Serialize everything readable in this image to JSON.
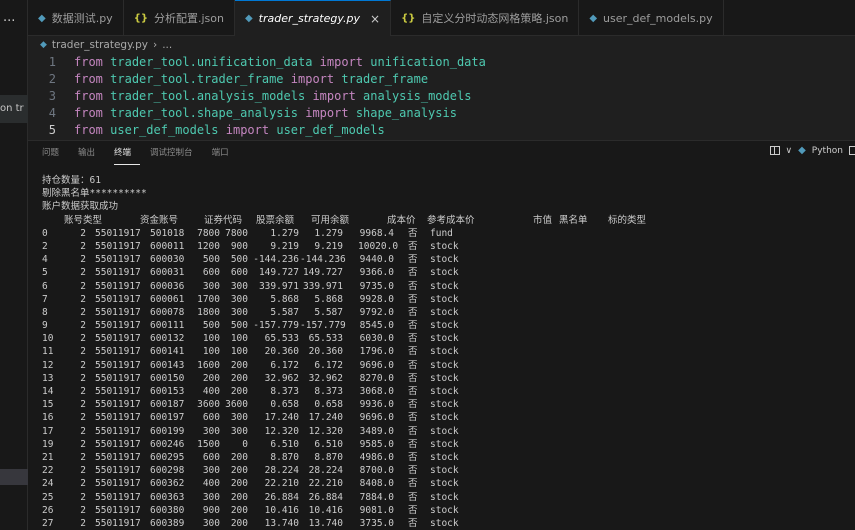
{
  "left_strip": {
    "ellipsis": "···",
    "partial_text": "on tr",
    "top_glyphs": "·· ·····"
  },
  "tabs": [
    {
      "label": "数据测试.py",
      "icon": "python-file-icon",
      "active": false
    },
    {
      "label": "分析配置.json",
      "icon": "json-file-icon",
      "active": false
    },
    {
      "label": "trader_strategy.py",
      "icon": "python-file-icon",
      "active": true
    },
    {
      "label": "自定义分时动态网格策略.json",
      "icon": "json-file-icon",
      "active": false
    },
    {
      "label": "user_def_models.py",
      "icon": "python-file-icon",
      "active": false
    }
  ],
  "tab_close_glyph": "×",
  "breadcrumb": {
    "file": "trader_strategy.py",
    "separator": "›",
    "rest": "..."
  },
  "editor": {
    "lines": [
      {
        "n": "1",
        "kw1": "from",
        "mod": "trader_tool.unification_data",
        "kw2": "import",
        "name": "unification_data"
      },
      {
        "n": "2",
        "kw1": "from",
        "mod": "trader_tool.trader_frame",
        "kw2": "import",
        "name": "trader_frame"
      },
      {
        "n": "3",
        "kw1": "from",
        "mod": "trader_tool.analysis_models",
        "kw2": "import",
        "name": "analysis_models"
      },
      {
        "n": "4",
        "kw1": "from",
        "mod": "trader_tool.shape_analysis",
        "kw2": "import",
        "name": "shape_analysis"
      },
      {
        "n": "5",
        "kw1": "from",
        "mod": "user_def_models",
        "kw2": "import",
        "name": "user_def_models"
      }
    ]
  },
  "panel": {
    "tabs": [
      "问题",
      "输出",
      "终端",
      "调试控制台",
      "端口"
    ],
    "active_tab": "终端",
    "language": "Python",
    "chevron": "∨"
  },
  "terminal": {
    "pre_lines": [
      "持仓数量：61",
      "剔除黑名单**********",
      "账户数据获取成功"
    ],
    "header": [
      "账号类型",
      "资金账号",
      "证券代码",
      "股票余额",
      "可用余额",
      "成本价",
      "参考成本价",
      "市值",
      "黑名单",
      "标的类型"
    ],
    "rows": [
      [
        "0",
        "2",
        "55011917",
        "501018",
        "7800",
        "7800",
        "1.279",
        "1.279",
        "9968.4",
        "否",
        "fund"
      ],
      [
        "2",
        "2",
        "55011917",
        "600011",
        "1200",
        "900",
        "9.219",
        "9.219",
        "10020.0",
        "否",
        "stock"
      ],
      [
        "4",
        "2",
        "55011917",
        "600030",
        "500",
        "500",
        "-144.236",
        "-144.236",
        "9440.0",
        "否",
        "stock"
      ],
      [
        "5",
        "2",
        "55011917",
        "600031",
        "600",
        "600",
        "149.727",
        "149.727",
        "9366.0",
        "否",
        "stock"
      ],
      [
        "6",
        "2",
        "55011917",
        "600036",
        "300",
        "300",
        "339.971",
        "339.971",
        "9735.0",
        "否",
        "stock"
      ],
      [
        "7",
        "2",
        "55011917",
        "600061",
        "1700",
        "300",
        "5.868",
        "5.868",
        "9928.0",
        "否",
        "stock"
      ],
      [
        "8",
        "2",
        "55011917",
        "600078",
        "1800",
        "300",
        "5.587",
        "5.587",
        "9792.0",
        "否",
        "stock"
      ],
      [
        "9",
        "2",
        "55011917",
        "600111",
        "500",
        "500",
        "-157.779",
        "-157.779",
        "8545.0",
        "否",
        "stock"
      ],
      [
        "10",
        "2",
        "55011917",
        "600132",
        "100",
        "100",
        "65.533",
        "65.533",
        "6030.0",
        "否",
        "stock"
      ],
      [
        "11",
        "2",
        "55011917",
        "600141",
        "100",
        "100",
        "20.360",
        "20.360",
        "1796.0",
        "否",
        "stock"
      ],
      [
        "12",
        "2",
        "55011917",
        "600143",
        "1600",
        "200",
        "6.172",
        "6.172",
        "9696.0",
        "否",
        "stock"
      ],
      [
        "13",
        "2",
        "55011917",
        "600150",
        "200",
        "200",
        "32.962",
        "32.962",
        "8270.0",
        "否",
        "stock"
      ],
      [
        "14",
        "2",
        "55011917",
        "600153",
        "400",
        "200",
        "8.373",
        "8.373",
        "3068.0",
        "否",
        "stock"
      ],
      [
        "15",
        "2",
        "55011917",
        "600187",
        "3600",
        "3600",
        "0.658",
        "0.658",
        "9936.0",
        "否",
        "stock"
      ],
      [
        "16",
        "2",
        "55011917",
        "600197",
        "600",
        "300",
        "17.240",
        "17.240",
        "9696.0",
        "否",
        "stock"
      ],
      [
        "17",
        "2",
        "55011917",
        "600199",
        "300",
        "300",
        "12.320",
        "12.320",
        "3489.0",
        "否",
        "stock"
      ],
      [
        "19",
        "2",
        "55011917",
        "600246",
        "1500",
        "0",
        "6.510",
        "6.510",
        "9585.0",
        "否",
        "stock"
      ],
      [
        "21",
        "2",
        "55011917",
        "600295",
        "600",
        "200",
        "8.870",
        "8.870",
        "4986.0",
        "否",
        "stock"
      ],
      [
        "22",
        "2",
        "55011917",
        "600298",
        "300",
        "200",
        "28.224",
        "28.224",
        "8700.0",
        "否",
        "stock"
      ],
      [
        "24",
        "2",
        "55011917",
        "600362",
        "400",
        "200",
        "22.210",
        "22.210",
        "8408.0",
        "否",
        "stock"
      ],
      [
        "25",
        "2",
        "55011917",
        "600363",
        "300",
        "200",
        "26.884",
        "26.884",
        "7884.0",
        "否",
        "stock"
      ],
      [
        "26",
        "2",
        "55011917",
        "600380",
        "900",
        "200",
        "10.416",
        "10.416",
        "9081.0",
        "否",
        "stock"
      ],
      [
        "27",
        "2",
        "55011917",
        "600389",
        "300",
        "200",
        "13.740",
        "13.740",
        "3735.0",
        "否",
        "stock"
      ]
    ]
  }
}
